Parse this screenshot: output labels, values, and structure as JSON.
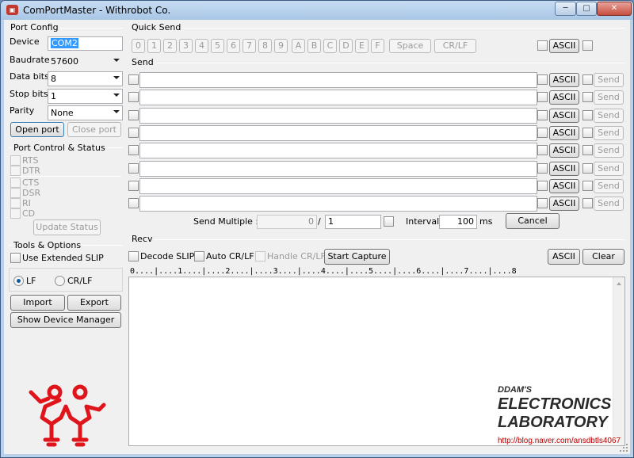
{
  "window": {
    "title": "ComPortMaster - Withrobot Co.",
    "app_icon": "ComPortMaster-icon",
    "controls": {
      "minimize": "─",
      "maximize": "□",
      "close": "✕"
    }
  },
  "port_config": {
    "title": "Port Config",
    "device_label": "Device",
    "device_value": "COM2",
    "baudrate_label": "Baudrate",
    "baudrate_value": "57600",
    "databits_label": "Data bits",
    "databits_value": "8",
    "stopbits_label": "Stop bits",
    "stopbits_value": "1",
    "parity_label": "Parity",
    "parity_value": "None",
    "open_button": "Open port",
    "close_button": "Close port"
  },
  "port_control": {
    "title": "Port Control & Status",
    "signals": [
      "RTS",
      "DTR",
      "CTS",
      "DSR",
      "RI",
      "CD"
    ],
    "update_button": "Update Status"
  },
  "tools": {
    "title": "Tools & Options",
    "extended_slip": "Use Extended SLIP",
    "lf": "LF",
    "crlf": "CR/LF",
    "import_button": "Import",
    "export_button": "Export",
    "device_manager_button": "Show Device Manager"
  },
  "quick_send": {
    "title": "Quick Send",
    "keys": [
      "0",
      "1",
      "2",
      "3",
      "4",
      "5",
      "6",
      "7",
      "8",
      "9",
      "A",
      "B",
      "C",
      "D",
      "E",
      "F"
    ],
    "space": "Space",
    "crlf": "CR/LF",
    "ascii": "ASCII"
  },
  "send": {
    "title": "Send",
    "rows": 8,
    "ascii": "ASCII",
    "send_button": "Send",
    "multiple_label": "Send Multiple :",
    "multiple_count": "0",
    "slash": "/",
    "multiple_total": "1",
    "interval_label": "Interval",
    "interval_value": "100",
    "interval_unit": "ms",
    "cancel_button": "Cancel"
  },
  "recv": {
    "title": "Recv",
    "decode_slip": "Decode SLIP",
    "auto_crlf": "Auto CR/LF",
    "handle_crlf": "Handle CR/LF",
    "capture_button": "Start Capture",
    "ascii_button": "ASCII",
    "clear_button": "Clear",
    "ruler": "0....|....1....|....2....|....3....|....4....|....5....|....6....|....7....|....8"
  },
  "watermark": {
    "line1": "DDAM'S",
    "line2": "ELECTRONICS",
    "line3": "LABORATORY",
    "url": "http://blog.naver.com/ansdbtls4067"
  },
  "colors": {
    "logo_red": "#e0151b",
    "selection_blue": "#3399ff",
    "url_red": "#c00000"
  }
}
